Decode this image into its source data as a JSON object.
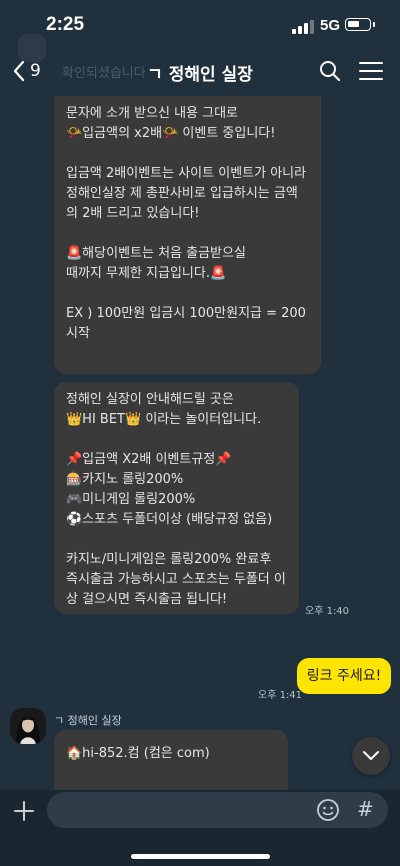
{
  "status": {
    "time": "2:25",
    "network": "5G"
  },
  "header": {
    "back_count": "9",
    "title": "ㄱ 정해인 실장"
  },
  "faded_text": "확인되셨습니다",
  "messages": {
    "bubble1": "문자에 소개 받으신 내용 그대로\n📯입금액의 x2배📯 이벤트 중입니다!\n\n입금액 2배이벤트는 사이트 이벤트가 아니라\n정해인실장 제 총판사비로 입급하시는 금액의 2배 드리고 있습니다!\n\n🚨해당이벤트는 처음 출금받으실\n때까지 무제한 지급입니다.🚨\n\nEX ) 100만원 입금시 100만원지급 = 200시작",
    "bubble2": "정해인 실장이 안내해드릴 곳은\n👑HI BET👑 이라는 놀이터입니다.\n\n📌입금액 X2배 이벤트규정📌\n🎰카지노 롤링200%\n🎮미니게임 롤링200%\n⚽스포츠 두폴더이상 (배당규정 없음)\n\n카지노/미니게임은 롤링200% 완료후 즉시출금 가능하시고 스포츠는 두폴더 이상 걸으시면 즉시출금 됩니다!",
    "time1": "오후 1:40",
    "my_message": "링크 주세요!",
    "time2": "오후 1:41",
    "sender_name": "ㄱ 정해인 실장",
    "bubble3": "🏠hi-852.컴 (컴은 com)"
  },
  "input": {
    "placeholder": "",
    "hash": "#"
  },
  "colors": {
    "background": "#21303d",
    "bubble": "#3a3a3a",
    "my_bubble": "#fee500"
  }
}
